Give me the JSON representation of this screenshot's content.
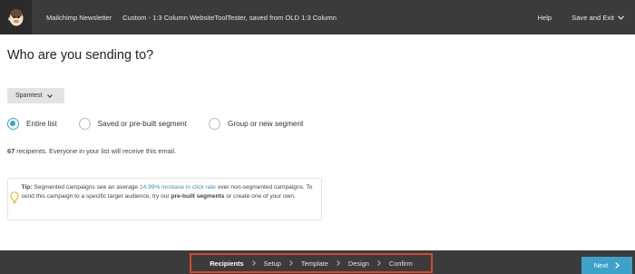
{
  "header": {
    "campaign_name": "Mailchimp Newsletter",
    "campaign_template": "Custom - 1:3 Column WebsiteToolTester, saved from OLD 1:3 Column",
    "help_label": "Help",
    "save_exit_label": "Save and Exit",
    "logo_icon": "mailchimp-logo"
  },
  "main": {
    "title": "Who are you sending to?",
    "list_select": {
      "value": "Spamtest"
    },
    "radio_options": [
      {
        "label": "Entire list",
        "checked": true
      },
      {
        "label": "Saved or pre-built segment",
        "checked": false
      },
      {
        "label": "Group or new segment",
        "checked": false
      }
    ],
    "recipients": {
      "count": "67",
      "text": "recipients. Everyone in your list will receive this email."
    },
    "tip": {
      "label": "Tip:",
      "text_1": "Segmented campaigns see an average",
      "link": "14.99% increase in click rate",
      "text_2": "over non-segmented campaigns. To send this campaign to a specific target audience, try our",
      "bold": "pre-built segments",
      "text_3": "or create one of your own.",
      "icon": "lightbulb-icon",
      "icon_color": "#e8b53a"
    }
  },
  "footer": {
    "steps": [
      "Recipients",
      "Setup",
      "Template",
      "Design",
      "Confirm"
    ],
    "active_step": "Recipients",
    "next_label": "Next",
    "highlight_color": "#d9462f",
    "accent": "#3ea2c8"
  }
}
